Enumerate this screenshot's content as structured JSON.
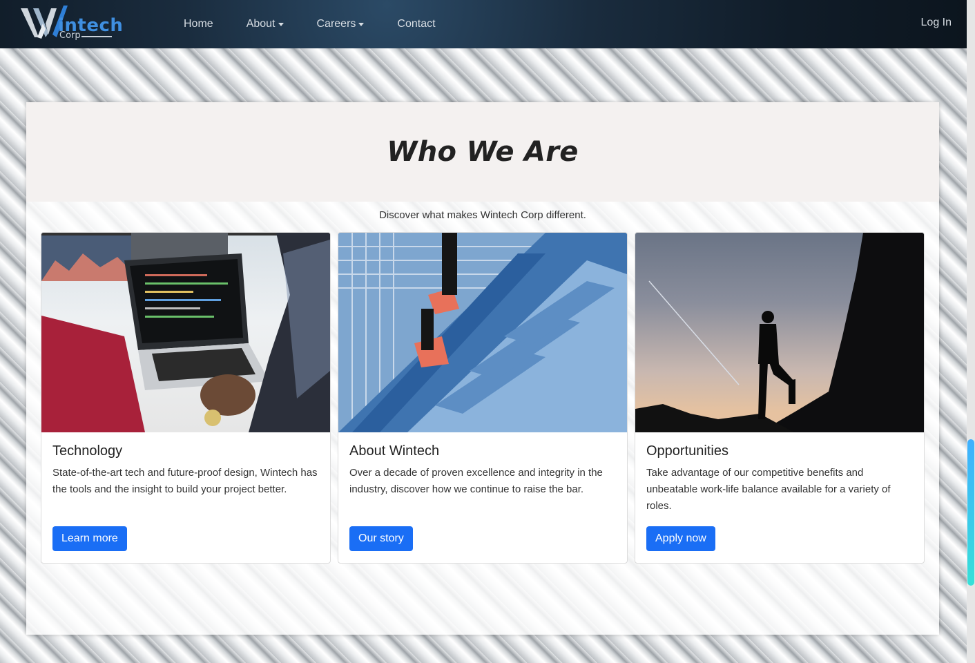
{
  "nav": {
    "brand": "intech",
    "brand_sub": "Corp",
    "links": [
      {
        "label": "Home",
        "dropdown": false
      },
      {
        "label": "About",
        "dropdown": true
      },
      {
        "label": "Careers",
        "dropdown": true
      },
      {
        "label": "Contact",
        "dropdown": false
      }
    ],
    "login": "Log In"
  },
  "hero": {
    "title": "Who We Are",
    "subtitle": "Discover what makes Wintech Corp different."
  },
  "cards": [
    {
      "title": "Technology",
      "text": "State-of-the-art tech and future-proof design, Wintech has the tools and the insight to build your project better.",
      "button": "Learn more"
    },
    {
      "title": "About Wintech",
      "text": "Over a decade of proven excellence and integrity in the industry, discover how we continue to raise the bar.",
      "button": "Our story"
    },
    {
      "title": "Opportunities",
      "text": "Take advantage of our competitive benefits and unbeatable work-life balance available for a variety of roles.",
      "button": "Apply now"
    }
  ],
  "colors": {
    "primary_button": "#1a6ef5",
    "navbar": "#101c28",
    "hero_bg": "#f4f1f0"
  }
}
